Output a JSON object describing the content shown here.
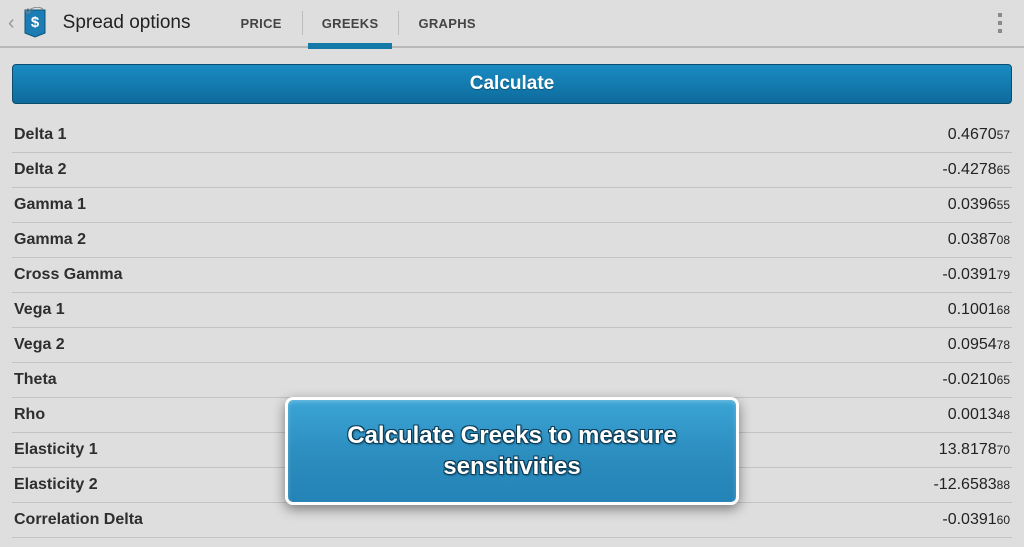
{
  "header": {
    "title": "Spread options",
    "tabs": [
      "PRICE",
      "GREEKS",
      "GRAPHS"
    ],
    "active_tab": 1
  },
  "calc_button": "Calculate",
  "rows": [
    {
      "label": "Delta 1",
      "big": "0.4670",
      "sm": "57"
    },
    {
      "label": "Delta 2",
      "big": "-0.4278",
      "sm": "65"
    },
    {
      "label": "Gamma 1",
      "big": "0.0396",
      "sm": "55"
    },
    {
      "label": "Gamma 2",
      "big": "0.0387",
      "sm": "08"
    },
    {
      "label": "Cross Gamma",
      "big": "-0.0391",
      "sm": "79"
    },
    {
      "label": "Vega 1",
      "big": "0.1001",
      "sm": "68"
    },
    {
      "label": "Vega 2",
      "big": "0.0954",
      "sm": "78"
    },
    {
      "label": "Theta",
      "big": "-0.0210",
      "sm": "65"
    },
    {
      "label": "Rho",
      "big": "0.0013",
      "sm": "48"
    },
    {
      "label": "Elasticity 1",
      "big": "13.8178",
      "sm": "70"
    },
    {
      "label": "Elasticity 2",
      "big": "-12.6583",
      "sm": "88"
    },
    {
      "label": "Correlation Delta",
      "big": "-0.0391",
      "sm": "60"
    }
  ],
  "overlay_text": "Calculate Greeks to measure sensitivities"
}
